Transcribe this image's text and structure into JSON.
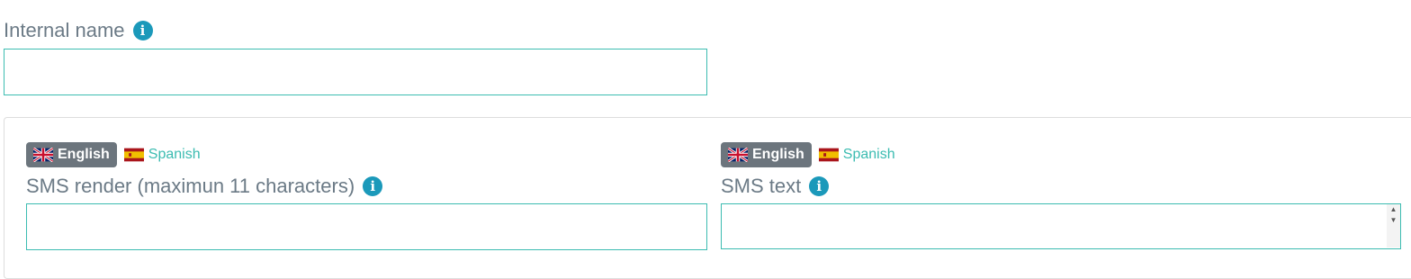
{
  "internal_name": {
    "label": "Internal name",
    "value": "",
    "placeholder": ""
  },
  "sms_render": {
    "languages": {
      "active": "English",
      "other": "Spanish"
    },
    "label": "SMS render (maximun 11 characters)",
    "value": "",
    "placeholder": ""
  },
  "sms_text": {
    "languages": {
      "active": "English",
      "other": "Spanish"
    },
    "label": "SMS text",
    "value": "",
    "placeholder": ""
  },
  "colors": {
    "accent": "#3cbcb1",
    "info_icon": "#1b99ba",
    "label_text": "#6b7a86",
    "active_language_bg": "#6c757d"
  },
  "icons": {
    "info": "info-icon",
    "english_flag": "uk-flag-icon",
    "spanish_flag": "spain-flag-icon"
  }
}
